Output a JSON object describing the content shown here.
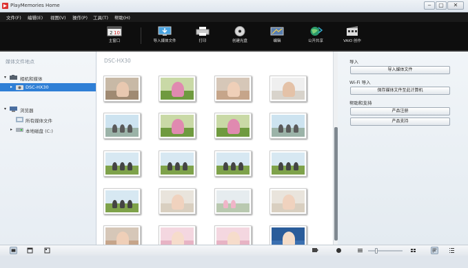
{
  "window": {
    "title": "PlayMemories Home",
    "minimize": "‒",
    "maximize": "▢",
    "close": "✕"
  },
  "menu": [
    "文件(F)",
    "编辑(E)",
    "视图(V)",
    "操作(P)",
    "工具(T)",
    "帮助(H)"
  ],
  "toolbar": [
    {
      "label": "主窗口",
      "icon": "calendar-icon"
    },
    {
      "label": "导入媒体文件",
      "icon": "import-icon"
    },
    {
      "label": "打印",
      "icon": "printer-icon"
    },
    {
      "label": "创建光盘",
      "icon": "disc-icon"
    },
    {
      "label": "编辑",
      "icon": "edit-icon"
    },
    {
      "label": "公开共享",
      "icon": "globe-icon"
    },
    {
      "label": "VAIO 创作",
      "icon": "film-icon"
    }
  ],
  "left": {
    "header": "媒体文件地点",
    "tree": [
      {
        "label": "相机和媒体",
        "icon": "camera-group-icon",
        "arrow": "▾",
        "level": 0,
        "selected": false
      },
      {
        "label": "DSC-HX30",
        "icon": "camera-icon",
        "arrow": "▸",
        "level": 1,
        "selected": true
      },
      {
        "label": "浏览器",
        "icon": "computer-icon",
        "arrow": "▾",
        "level": 0,
        "selected": false
      },
      {
        "label": "所有媒体文件",
        "icon": "media-icon",
        "arrow": "",
        "level": 1,
        "selected": false
      },
      {
        "label": "本地磁盘 (C:)",
        "icon": "disk-icon",
        "arrow": "▸",
        "level": 1,
        "selected": false
      }
    ]
  },
  "main": {
    "title": "DSC-HX30",
    "thumbnails": [
      {
        "kind": "indoor"
      },
      {
        "kind": "outdoor"
      },
      {
        "kind": "portrait"
      },
      {
        "kind": "indoor-white"
      },
      {
        "kind": "beach"
      },
      {
        "kind": "outdoor"
      },
      {
        "kind": "outdoor"
      },
      {
        "kind": "beach"
      },
      {
        "kind": "field"
      },
      {
        "kind": "field"
      },
      {
        "kind": "field"
      },
      {
        "kind": "field"
      },
      {
        "kind": "field"
      },
      {
        "kind": "baby"
      },
      {
        "kind": "kids"
      },
      {
        "kind": "baby"
      },
      {
        "kind": "portrait"
      },
      {
        "kind": "baby-pink"
      },
      {
        "kind": "baby-pink"
      },
      {
        "kind": "baby-blue"
      }
    ]
  },
  "right": {
    "sections": [
      {
        "heading": "导入",
        "buttons": [
          "导入媒体文件"
        ]
      },
      {
        "heading": "Wi-Fi 导入",
        "buttons": [
          "保存媒体文件至此计算机"
        ]
      },
      {
        "heading": "帮助和支持",
        "buttons": [
          "产品注册",
          "产品支持"
        ]
      }
    ]
  },
  "colors": {
    "selection": "#2f7fd6",
    "toolbar_bg": "#0e0e0e"
  }
}
